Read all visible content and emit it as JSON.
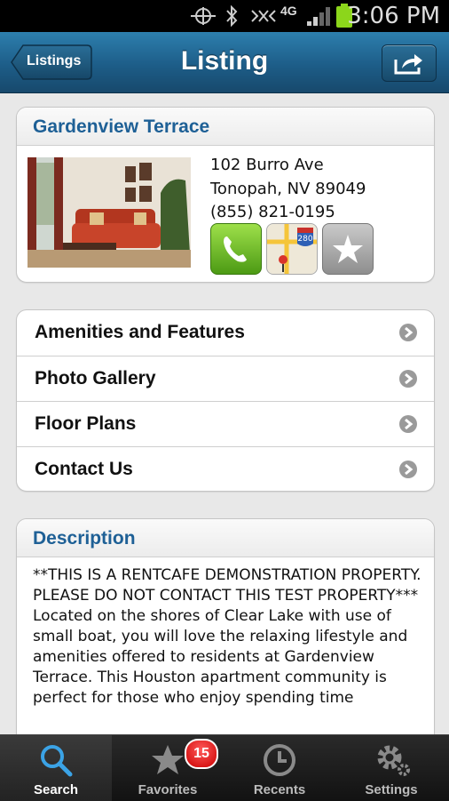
{
  "status_bar": {
    "time": "3:06 PM",
    "network": "4G",
    "icons": [
      "location-icon",
      "bluetooth-icon",
      "vibrate-icon",
      "signal-icon",
      "battery-icon"
    ]
  },
  "nav": {
    "back_label": "Listings",
    "title": "Listing",
    "share_icon": "share-icon"
  },
  "property": {
    "name": "Gardenview Terrace",
    "address_line1": "102 Burro Ave",
    "address_line2": "Tonopah, NV 89049",
    "phone": "(855) 821-0195",
    "actions": [
      "phone-icon",
      "map-icon",
      "star-icon"
    ]
  },
  "menu": {
    "items": [
      {
        "label": "Amenities and Features"
      },
      {
        "label": "Photo Gallery"
      },
      {
        "label": "Floor Plans"
      },
      {
        "label": "Contact Us"
      }
    ]
  },
  "description": {
    "title": "Description",
    "text": "**THIS IS A RENTCAFE DEMONSTRATION PROPERTY.  PLEASE DO NOT CONTACT THIS TEST PROPERTY***\nLocated on the shores of Clear Lake with use of small boat, you will love the relaxing lifestyle and amenities offered to residents at Gardenview Terrace. This Houston apartment community is perfect for those who enjoy spending time"
  },
  "tabs": [
    {
      "label": "Search",
      "icon": "search-icon",
      "active": true
    },
    {
      "label": "Favorites",
      "icon": "star-icon",
      "badge": "15"
    },
    {
      "label": "Recents",
      "icon": "clock-icon"
    },
    {
      "label": "Settings",
      "icon": "gear-icon"
    }
  ],
  "colors": {
    "nav_bar": "#1d5d88",
    "heading_blue": "#1e6096",
    "badge_red": "#dd1111"
  }
}
